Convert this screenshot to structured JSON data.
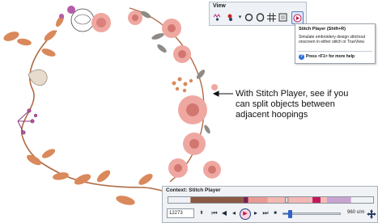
{
  "view_toolbar": {
    "title": "View",
    "icons": [
      "show-stitches-icon",
      "show-objects-icon",
      "zoom-icon",
      "hoop-icon",
      "grid-icon",
      "frame-icon",
      "stitch-player-icon"
    ]
  },
  "tooltip": {
    "title": "Stitch Player (Shift+R)",
    "description": "Simulate embroidery design stitchout onscreen in either stitch or TrueView.",
    "help": "Press <F1> for more help"
  },
  "callout": {
    "text": "With Stitch Player, see if you can split objects between adjacent hoopings"
  },
  "stitch_player": {
    "title": "Context: Stitch Player",
    "stitch_number": "12273",
    "speed": "960 s/m",
    "speed_fraction": 0.12,
    "progress_fraction": 0.6,
    "buttons": [
      "go-to-start",
      "previous-object",
      "step-back",
      "play",
      "step-forward",
      "next-object",
      "go-to-end"
    ],
    "progress_colors": [
      "#8a5a44",
      "#7b1f4e",
      "#e99a95",
      "#f2b8b4",
      "#c2185b",
      "#f3bdb8",
      "#c9a3cf"
    ]
  },
  "colors": {
    "rose": "#e7a19a",
    "rose_dark": "#c86b62",
    "leaf": "#d88a5e",
    "stem": "#a0533a",
    "grey_leaf": "#8e8a86",
    "purple": "#b65ca8"
  }
}
